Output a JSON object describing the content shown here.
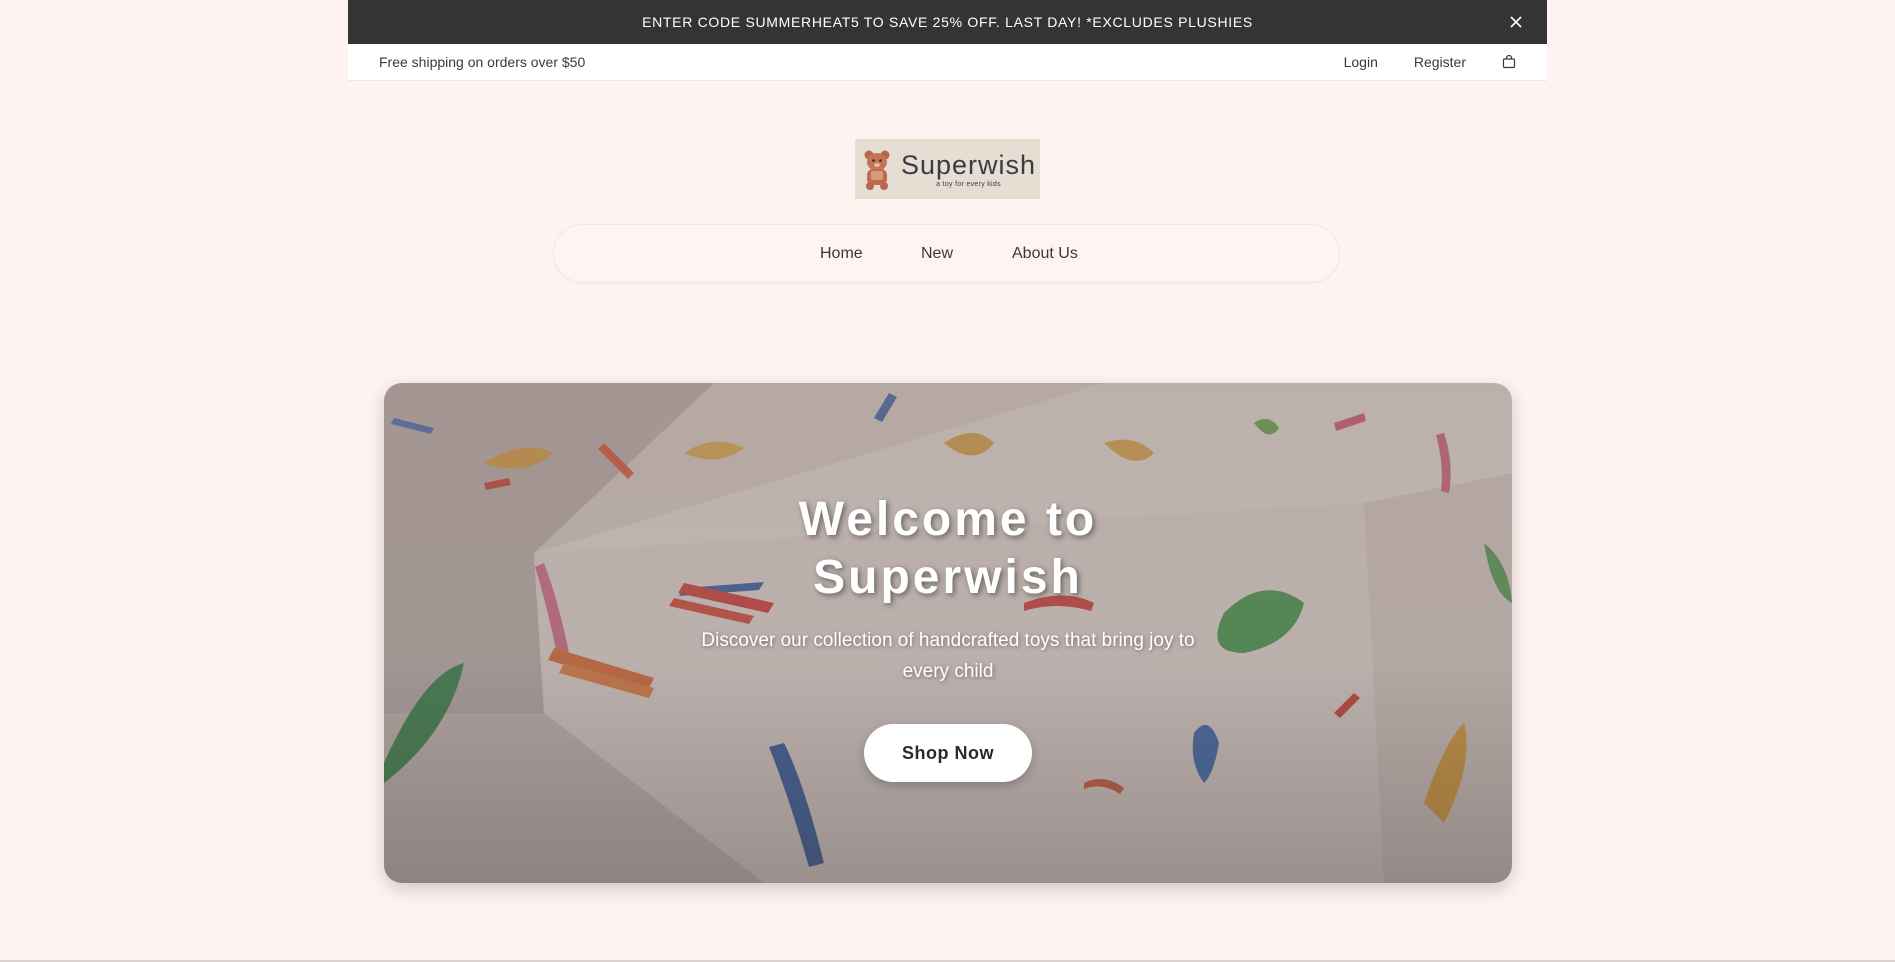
{
  "announcement": {
    "text": "ENTER CODE SUMMERHEAT5 TO SAVE 25% OFF. LAST DAY! *EXCLUDES PLUSHIES",
    "close_icon": "close-icon"
  },
  "utility_bar": {
    "shipping_text": "Free shipping on orders over $50",
    "login_label": "Login",
    "register_label": "Register",
    "cart_icon": "shopping-bag-icon"
  },
  "logo": {
    "name": "Superwish",
    "tagline": "a toy for every kids"
  },
  "nav": {
    "items": [
      {
        "label": "Home"
      },
      {
        "label": "New"
      },
      {
        "label": "About Us"
      }
    ]
  },
  "hero": {
    "title_line1": "Welcome to",
    "title_line2": "Superwish",
    "subtitle": "Discover our collection of handcrafted toys that bring joy to every child",
    "cta_label": "Shop Now"
  },
  "colors": {
    "page_background": "#fff3f1",
    "announcement_background": "#343434",
    "button_background": "#ffffff"
  }
}
